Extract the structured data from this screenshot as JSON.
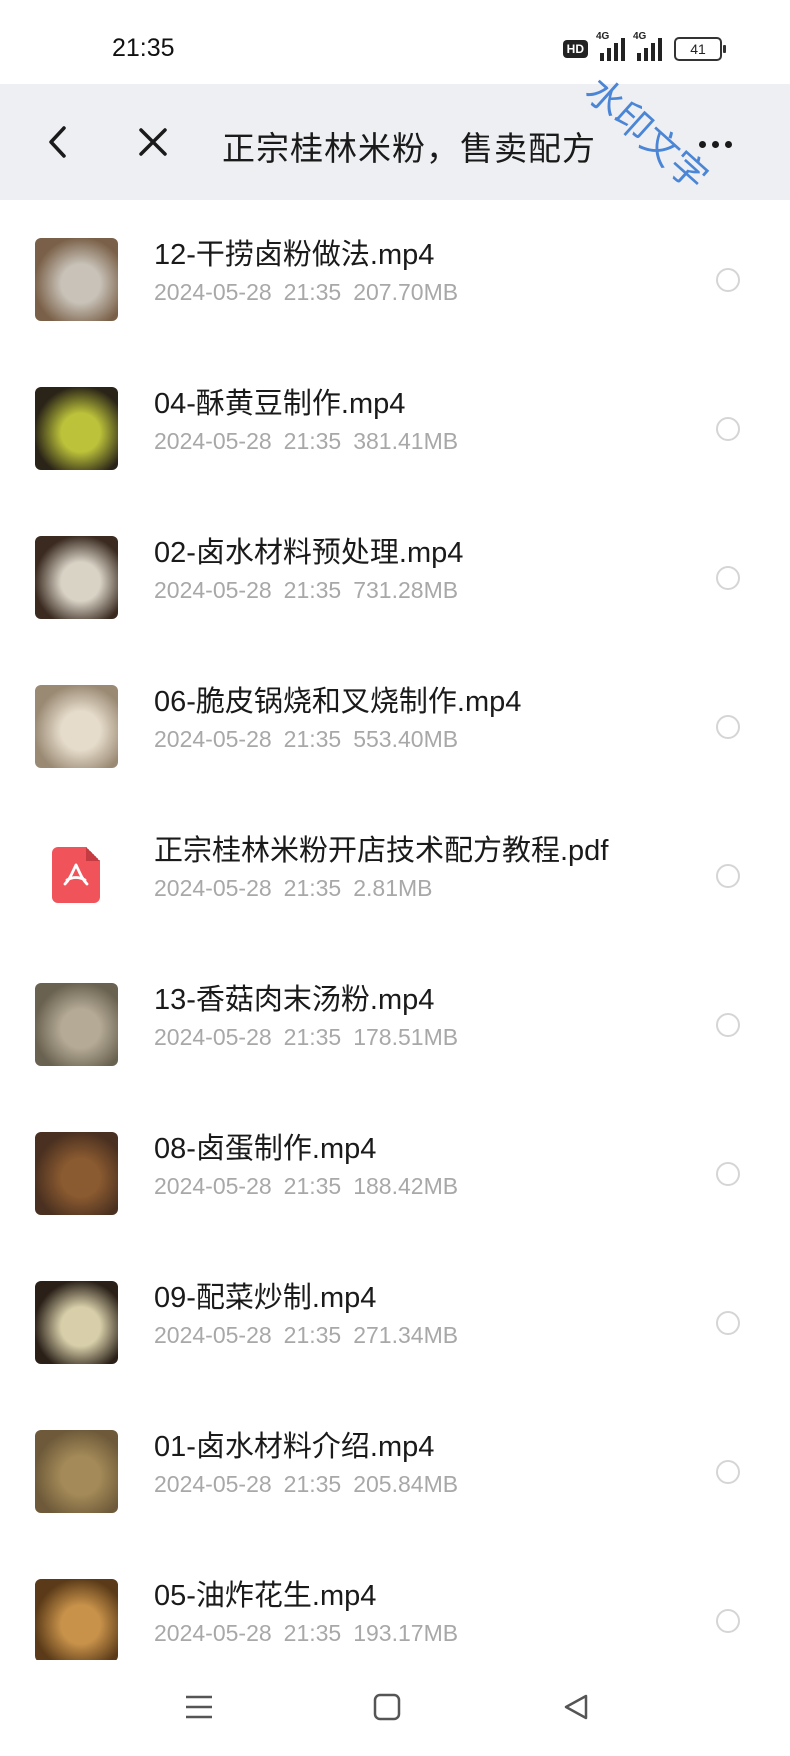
{
  "status_bar": {
    "time": "21:35",
    "hd_label": "HD",
    "network_1": "4G",
    "network_2": "4G",
    "battery": "41"
  },
  "header": {
    "title": "正宗桂林米粉，售卖配方",
    "back_icon": "chevron-left-icon",
    "close_icon": "close-icon",
    "more_icon": "more-dots-icon"
  },
  "watermark": {
    "text": "水印文字",
    "color": "#3d7dd4"
  },
  "files": [
    {
      "name": "12-干捞卤粉做法.mp4",
      "date": "2024-05-28",
      "time": "21:35",
      "size": "207.70MB",
      "kind": "video",
      "thumb_colors": [
        "#7a6048",
        "#c8c2b8"
      ]
    },
    {
      "name": "04-酥黄豆制作.mp4",
      "date": "2024-05-28",
      "time": "21:35",
      "size": "381.41MB",
      "kind": "video",
      "thumb_colors": [
        "#2a2418",
        "#bcc23a"
      ]
    },
    {
      "name": "02-卤水材料预处理.mp4",
      "date": "2024-05-28",
      "time": "21:35",
      "size": "731.28MB",
      "kind": "video",
      "thumb_colors": [
        "#3a2a20",
        "#d9d3c6"
      ]
    },
    {
      "name": "06-脆皮锅烧和叉烧制作.mp4",
      "date": "2024-05-28",
      "time": "21:35",
      "size": "553.40MB",
      "kind": "video",
      "thumb_colors": [
        "#9a8a74",
        "#e6dccb"
      ]
    },
    {
      "name": "正宗桂林米粉开店技术配方教程.pdf",
      "date": "2024-05-28",
      "time": "21:35",
      "size": "2.81MB",
      "kind": "pdf",
      "thumb_colors": [
        "#f0535a",
        "#ffffff"
      ]
    },
    {
      "name": "13-香菇肉末汤粉.mp4",
      "date": "2024-05-28",
      "time": "21:35",
      "size": "178.51MB",
      "kind": "video",
      "thumb_colors": [
        "#6a6250",
        "#b4aa96"
      ]
    },
    {
      "name": "08-卤蛋制作.mp4",
      "date": "2024-05-28",
      "time": "21:35",
      "size": "188.42MB",
      "kind": "video",
      "thumb_colors": [
        "#4a3020",
        "#8a5a30"
      ]
    },
    {
      "name": "09-配菜炒制.mp4",
      "date": "2024-05-28",
      "time": "21:35",
      "size": "271.34MB",
      "kind": "video",
      "thumb_colors": [
        "#2a2018",
        "#d8cfaa"
      ]
    },
    {
      "name": "01-卤水材料介绍.mp4",
      "date": "2024-05-28",
      "time": "21:35",
      "size": "205.84MB",
      "kind": "video",
      "thumb_colors": [
        "#6e5a3a",
        "#a48a58"
      ]
    },
    {
      "name": "05-油炸花生.mp4",
      "date": "2024-05-28",
      "time": "21:35",
      "size": "193.17MB",
      "kind": "video",
      "thumb_colors": [
        "#5a3a18",
        "#c8924a"
      ]
    }
  ],
  "nav_bar": {
    "menu_icon": "menu-icon",
    "home_icon": "home-square-icon",
    "back_icon": "back-triangle-icon"
  }
}
